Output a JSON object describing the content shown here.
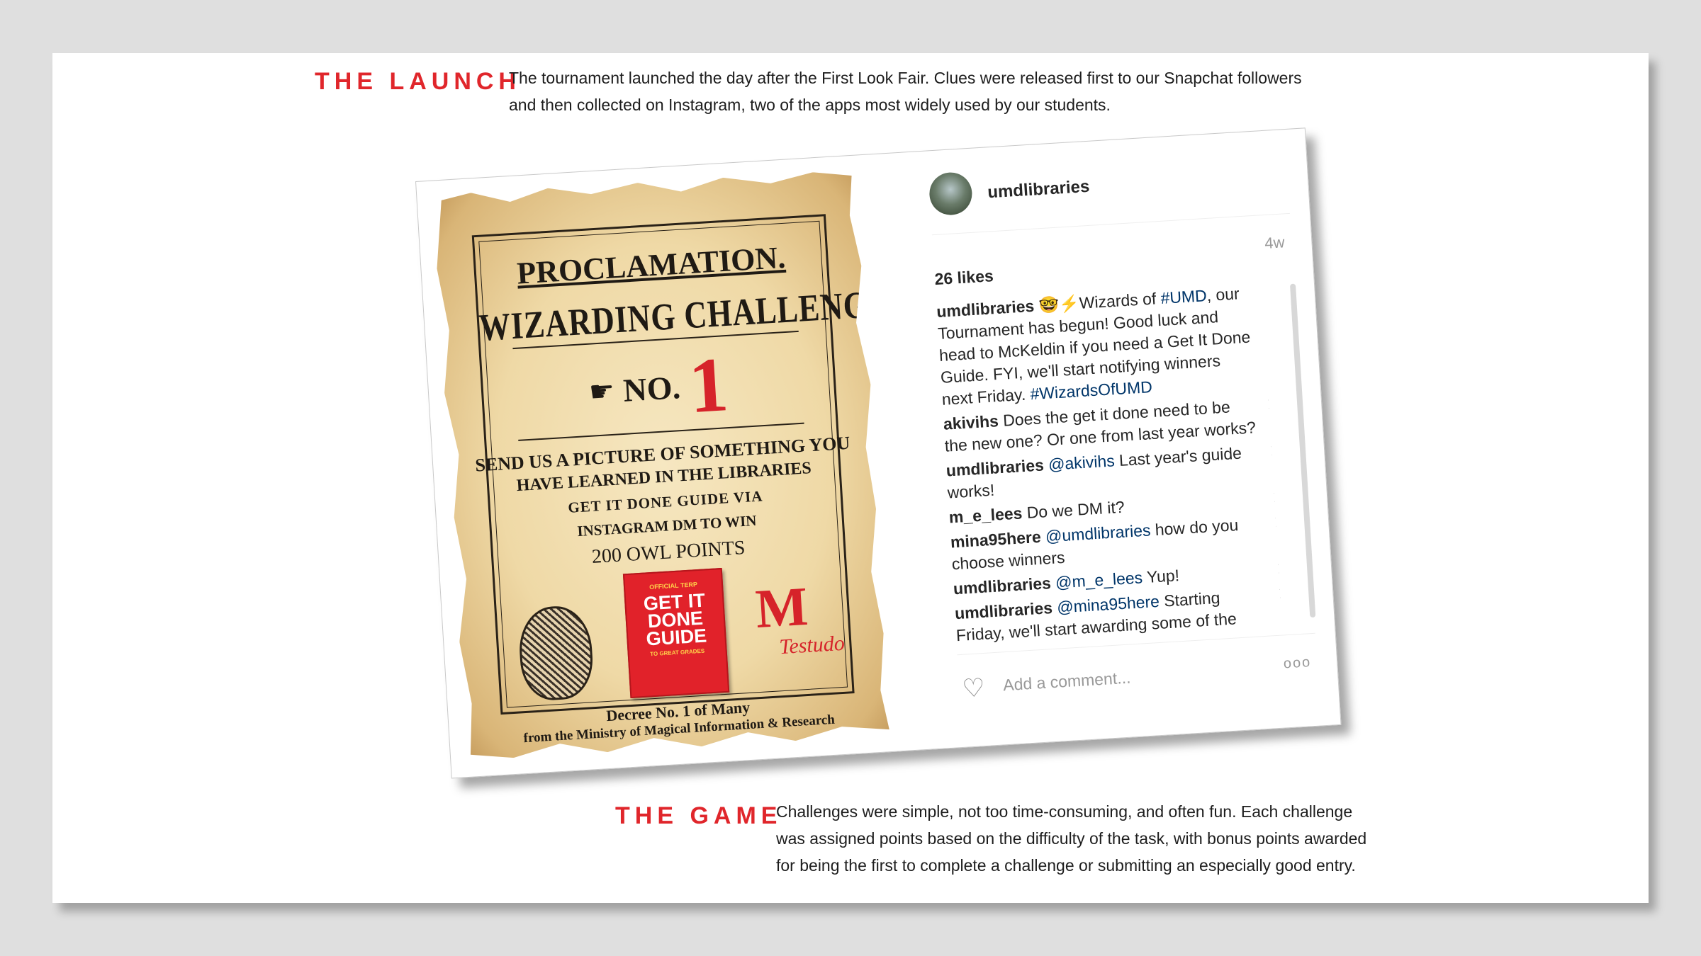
{
  "launch": {
    "heading": "THE LAUNCH",
    "text_lines": [
      "The tournament launched the day after the First Look Fair. Clues were released first to our Snapchat followers",
      "and then collected on Instagram, two of the apps most widely used by our students."
    ]
  },
  "poster": {
    "title": "PROCLAMATION.",
    "challenge": "WIZARDING CHALLENGE",
    "number_label": "NO.",
    "number": "1",
    "line1": "SEND US A PICTURE OF SOMETHING YOU",
    "line2": "HAVE LEARNED IN THE LIBRARIES",
    "line3": "GET IT DONE GUIDE VIA",
    "line4": "INSTAGRAM DM TO WIN",
    "points": "200 OWL POINTS",
    "book_top": "OFFICIAL TERP",
    "book_title": "GET IT DONE GUIDE",
    "book_sub": "TO GREAT GRADES",
    "logo_letter": "M",
    "logo_script": "Testudo",
    "decree": "Decree No. 1 of Many",
    "ministry": "from the Ministry of Magical Information & Research"
  },
  "instagram": {
    "username": "umdlibraries",
    "time_ago": "4w",
    "likes": "26 likes",
    "comments": [
      {
        "user": "umdlibraries",
        "pre": " 🤓⚡Wizards of ",
        "tag": "#UMD",
        "post": ", our Tournament has begun! Good luck and head to McKeldin if you need a Get It Done Guide. FYI, we'll start notifying winners next Friday. ",
        "tag2": "#WizardsOfUMD"
      },
      {
        "user": "akivihs",
        "pre": " Does the get it done need to be the new one? Or one from last year works?",
        "tag": "",
        "post": "",
        "tag2": ""
      },
      {
        "user": "umdlibraries",
        "pre": " ",
        "tag": "@akivihs",
        "post": " Last year's guide works!",
        "tag2": ""
      },
      {
        "user": "m_e_lees",
        "pre": " Do we DM it?",
        "tag": "",
        "post": "",
        "tag2": ""
      },
      {
        "user": "mina95here",
        "pre": " ",
        "tag": "@umdlibraries",
        "post": " how do you choose winners",
        "tag2": ""
      },
      {
        "user": "umdlibraries",
        "pre": " ",
        "tag": "@m_e_lees",
        "post": " Yup!",
        "tag2": ""
      },
      {
        "user": "umdlibraries",
        "pre": " ",
        "tag": "@mina95here",
        "post": " Starting Friday, we'll start awarding some of the",
        "tag2": ""
      }
    ],
    "delete_glyph": "✕",
    "add_comment_placeholder": "Add a comment...",
    "more_glyph": "ooo",
    "heart_icon": "♡"
  },
  "game": {
    "heading": "THE GAME",
    "text_lines": [
      "Challenges were simple, not too time-consuming, and often fun. Each challenge",
      "was assigned points based on the difficulty of the task, with bonus points awarded",
      "for being the first to complete a challenge or submitting an especially good entry."
    ]
  },
  "colors": {
    "accent_red": "#e0262b",
    "instagram_link": "#003569",
    "background": "#dfdfdf"
  }
}
